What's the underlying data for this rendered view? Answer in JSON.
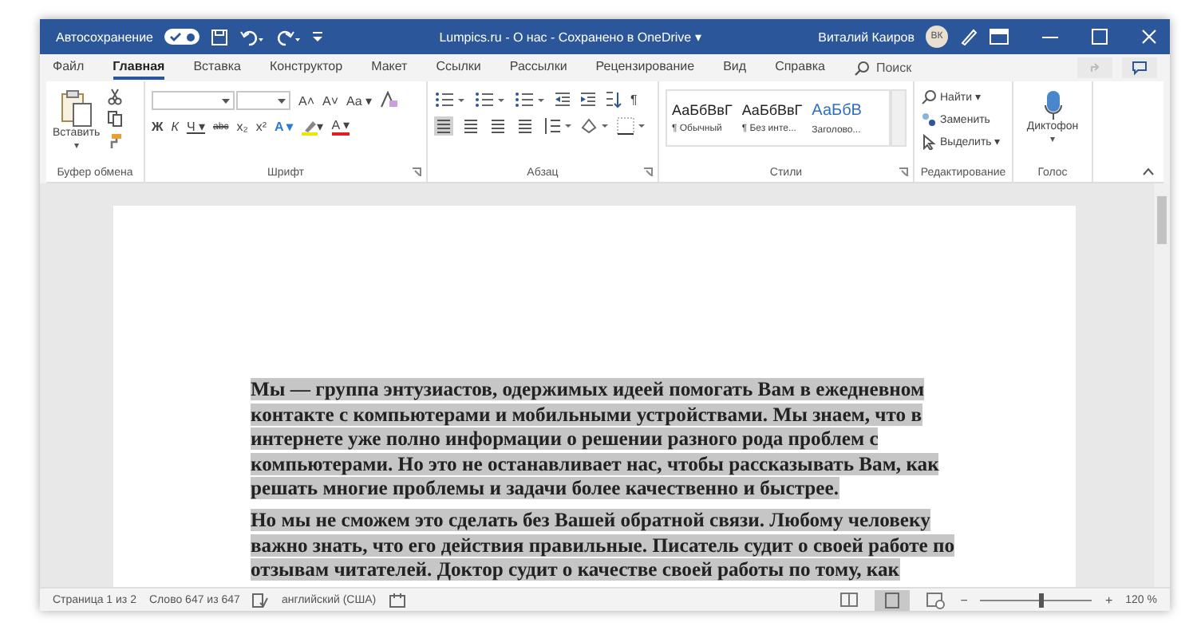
{
  "title_bar": {
    "autosave_label": "Автосохранение",
    "autosave_on": true,
    "title": "Lumpics.ru - О нас - Сохранено в OneDrive",
    "title_caret": "▾",
    "user_name": "Виталий Каиров",
    "avatar_initials": "ВК"
  },
  "tabs": [
    {
      "label": "Файл",
      "selected": false
    },
    {
      "label": "Главная",
      "selected": true
    },
    {
      "label": "Вставка",
      "selected": false
    },
    {
      "label": "Конструктор",
      "selected": false
    },
    {
      "label": "Макет",
      "selected": false
    },
    {
      "label": "Ссылки",
      "selected": false
    },
    {
      "label": "Рассылки",
      "selected": false
    },
    {
      "label": "Рецензирование",
      "selected": false
    },
    {
      "label": "Вид",
      "selected": false
    },
    {
      "label": "Справка",
      "selected": false
    }
  ],
  "search": {
    "placeholder": "Поиск"
  },
  "ribbon": {
    "clipboard": {
      "paste_label": "Вставить",
      "paste_caret": "▾",
      "group_label": "Буфер обмена"
    },
    "font": {
      "group_label": "Шрифт",
      "row1": [
        {
          "label": "A˄"
        },
        {
          "label": "A˅"
        },
        {
          "label": "Aa ▾"
        }
      ],
      "row2": [
        {
          "kind": "bold",
          "label": "Ж"
        },
        {
          "kind": "italic",
          "label": "К"
        },
        {
          "kind": "underline",
          "label": "Ч ▾"
        },
        {
          "kind": "strike",
          "label": "abc"
        },
        {
          "kind": "sub",
          "label": "x₂"
        },
        {
          "kind": "sup",
          "label": "x²"
        },
        {
          "kind": "effect",
          "label": "A ▾"
        },
        {
          "kind": "highlight",
          "label": "▾"
        },
        {
          "kind": "color",
          "label": "A ▾"
        }
      ]
    },
    "paragraph": {
      "group_label": "Абзац",
      "pilcrow": "¶"
    },
    "styles": {
      "group_label": "Стили",
      "items": [
        {
          "sample": "АаБбВвГ",
          "name": "¶ Обычный",
          "kind": "normal"
        },
        {
          "sample": "АаБбВвГ",
          "name": "¶ Без инте...",
          "kind": "normal"
        },
        {
          "sample": "АаБбВ",
          "name": "Заголово...",
          "kind": "heading"
        }
      ]
    },
    "editing": {
      "group_label": "Редактирование",
      "find": "Найти ▾",
      "replace": "Заменить",
      "select": "Выделить ▾"
    },
    "voice": {
      "group_label": "Голос",
      "dictate": "Диктофон",
      "caret": "▾"
    }
  },
  "document": {
    "paragraphs": [
      {
        "text": "Мы — группа энтузиастов, одержимых идеей помогать Вам в ежедневном контакте с компьютерами и мобильными устройствами. Мы знаем, что в интернете уже полно информации о решении разного рода проблем с компьютерами. Но это не останавливает нас, чтобы рассказывать Вам, как решать многие проблемы и задачи более качественно и быстрее.",
        "selected": true
      },
      {
        "text": "Но мы не сможем это сделать без Вашей обратной связи. Любому человеку важно знать, что его действия правильные. Писатель судит о своей работе по отзывам читателей. Доктор судит о качестве своей работы по тому, как",
        "selected": true
      }
    ]
  },
  "status_bar": {
    "page": "Страница 1 из 2",
    "words": "Слово 647 из 647",
    "language": "английский (США)",
    "zoom_minus": "−",
    "zoom_plus": "+",
    "zoom": {
      "level": 0.52
    },
    "zoom_value": "120 %"
  }
}
